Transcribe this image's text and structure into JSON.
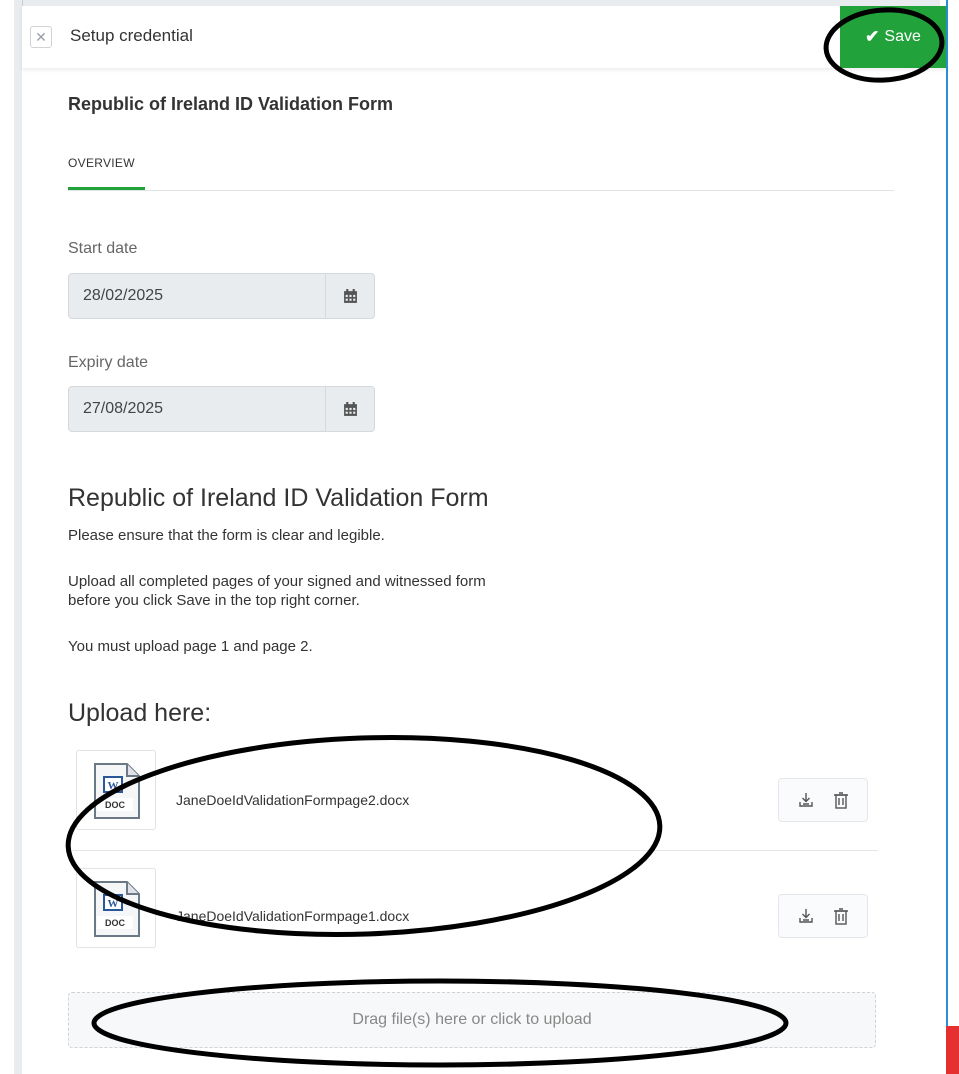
{
  "header": {
    "title": "Setup credential",
    "save_label": "Save",
    "close_icon": "close-icon",
    "check_icon": "check-icon"
  },
  "form": {
    "title": "Republic of Ireland ID Validation Form",
    "tabs": [
      {
        "label": "OVERVIEW",
        "active": true
      }
    ],
    "start_date": {
      "label": "Start date",
      "value": "28/02/2025"
    },
    "expiry_date": {
      "label": "Expiry date",
      "value": "27/08/2025"
    },
    "section_heading": "Republic of Ireland ID Validation Form",
    "paragraphs": [
      "Please ensure that the form is clear and legible.",
      "Upload all completed pages of your signed and witnessed form",
      "before you click Save in the top right corner.",
      "You must upload page 1 and page 2."
    ],
    "upload_heading": "Upload here:",
    "files": [
      {
        "name": "JaneDoeIdValidationFormpage2.docx",
        "type_label": "DOC"
      },
      {
        "name": "JaneDoeIdValidationFormpage1.docx",
        "type_label": "DOC"
      }
    ],
    "dropzone_text": "Drag file(s) here or click to upload"
  },
  "colors": {
    "accent": "#22a23a",
    "annotation": "#000000",
    "word_blue": "#2b579a"
  }
}
